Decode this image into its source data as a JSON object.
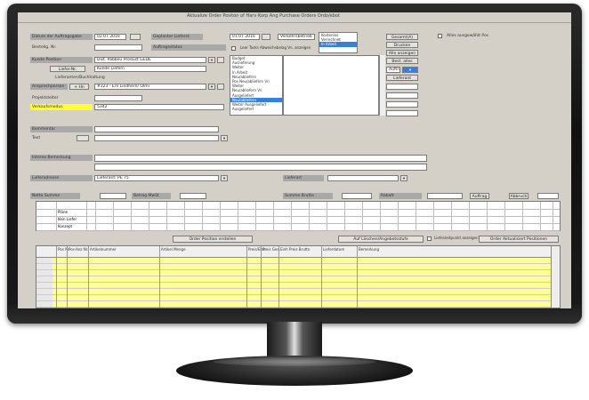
{
  "window": {
    "title": "Aktualize Order Positon of Harv Korp Ang Purchase Orders Ordo/ebot"
  },
  "header": {
    "order_date_label": "Datum der Auftragsgabe",
    "order_date_value": "02.07.2016",
    "reference_label": "Bestellg. Nr.",
    "customer_label": "Kunde Position",
    "customer_value": "Dist. Pabbeu Product GEDE",
    "delivery_label": "Liefer-Nr.",
    "delivery_value": "Kunde Liefern",
    "address_label": "Lieferanten/Buchhaltung",
    "contact_label": "Ansprechperson",
    "contact_value": "#323 - Ern Lindhern/ Olmi",
    "project_label": "Projektsleiter",
    "project_value": "5342",
    "mode_label": "Verkaufsmodus",
    "planned_label": "Geplanter Lieferst.",
    "planned_value": "01.07.2016",
    "order_type_label": "Auftragsstatus",
    "order_type_value": "Verkehrsbetrieb",
    "show_weeks_label": "Leer Tasks Abweichsbelag Vn. anzeigen",
    "status_value": "Auftrag"
  },
  "status_list": [
    "Kostenlos",
    "Verrechnet",
    "In Arbeit"
  ],
  "status_list_selected": 2,
  "code_list": [
    "Budget",
    "Auslieferung",
    "Weiter",
    "In Arbeit",
    "Neu/abliefern",
    "Pos Neu/abliefern Vn",
    "Weiter",
    "Neu/abliefern Vn",
    "Ausgeliefert",
    "Neu/abliefern",
    "Weiter Ausgeliefert",
    "Ausgeliefert"
  ],
  "code_list_selected": 9,
  "right_buttons": {
    "complete": "Gesamt(A)",
    "print": "Drucken",
    "overview": "Alle anzeigen",
    "extra": "Best. alles",
    "lieferer": "Lieferant"
  },
  "top_checkbox_label": "Alles ausgewählt Pos",
  "mid": {
    "notes_label": "Kommentar",
    "text_label": "Text",
    "internal_label": "Interne Bemerkung",
    "supplier_label": "Lieferadresse",
    "supplier_value": "Lieferant: PE 75",
    "delivery_type_label": "Lieferart"
  },
  "totals": {
    "net_label": "Netto Summe",
    "vat_label": "Betrag MwSt",
    "total_label": "Summe Brutto",
    "disc_label": "Rabatt",
    "ship_label": "Versand",
    "send_label": "Auftrag",
    "cancel_label": "Abbruch"
  },
  "grid1_rows": [
    "Pläne",
    "Kein Liefer",
    "Konzept"
  ],
  "actions": {
    "order_position": "Order Position erstellen",
    "add_position": "Auf Löschen/Angebotsstufe",
    "checkbox_label": "Lieferzeitpunkt anzeigen",
    "order_button": "Order Aktualisiert Positionen"
  },
  "grid2_headers": [
    "Pos Nr.",
    "Pos-Anz Nr.",
    "Artikelnummer",
    "Artikel Menge",
    "Preis/Einh",
    "Preis Ges.",
    "Einh Preis Brutto",
    "Lieferdatum",
    "Bemerkung"
  ],
  "grid2_row_count": 8
}
